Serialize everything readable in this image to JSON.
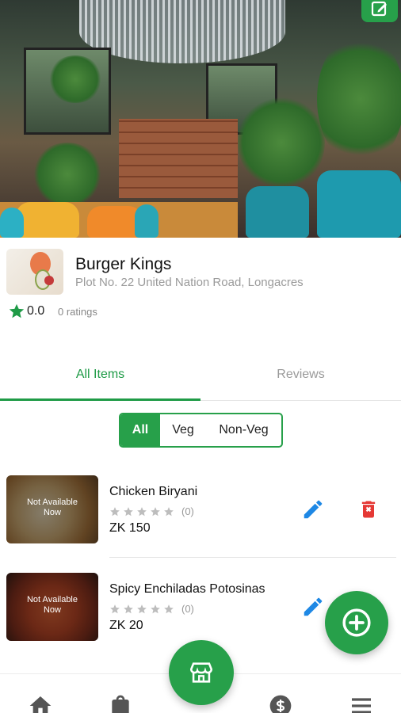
{
  "restaurant": {
    "name": "Burger Kings",
    "address": "Plot No. 22 United Nation Road, Longacres",
    "rating": "0.0",
    "ratings_count": "0 ratings"
  },
  "tabs": [
    {
      "label": "All Items",
      "active": true
    },
    {
      "label": "Reviews",
      "active": false
    }
  ],
  "filter": {
    "options": [
      "All",
      "Veg",
      "Non-Veg"
    ],
    "selected": "All"
  },
  "items": [
    {
      "name": "Chicken Biryani",
      "overlay": "Not Available Now",
      "rating_count": "(0)",
      "price": "ZK 150"
    },
    {
      "name": "Spicy Enchiladas Potosinas",
      "overlay": "Not Available Now",
      "rating_count": "(0)",
      "price": "ZK 20"
    }
  ],
  "colors": {
    "brand_green": "#27a04a",
    "tab_active": "#1f9b47",
    "edit_blue": "#1e88e5",
    "delete_red": "#e53935",
    "star_gray": "#bdbdbd"
  },
  "icons": {
    "edit_photo": "edit-square-icon",
    "rating": "star-icon",
    "edit_item": "pencil-icon",
    "delete_item": "trash-icon",
    "add_item": "plus-circle-icon",
    "nav": [
      "home-icon",
      "bag-icon",
      "store-icon",
      "dollar-icon",
      "menu-icon"
    ]
  }
}
